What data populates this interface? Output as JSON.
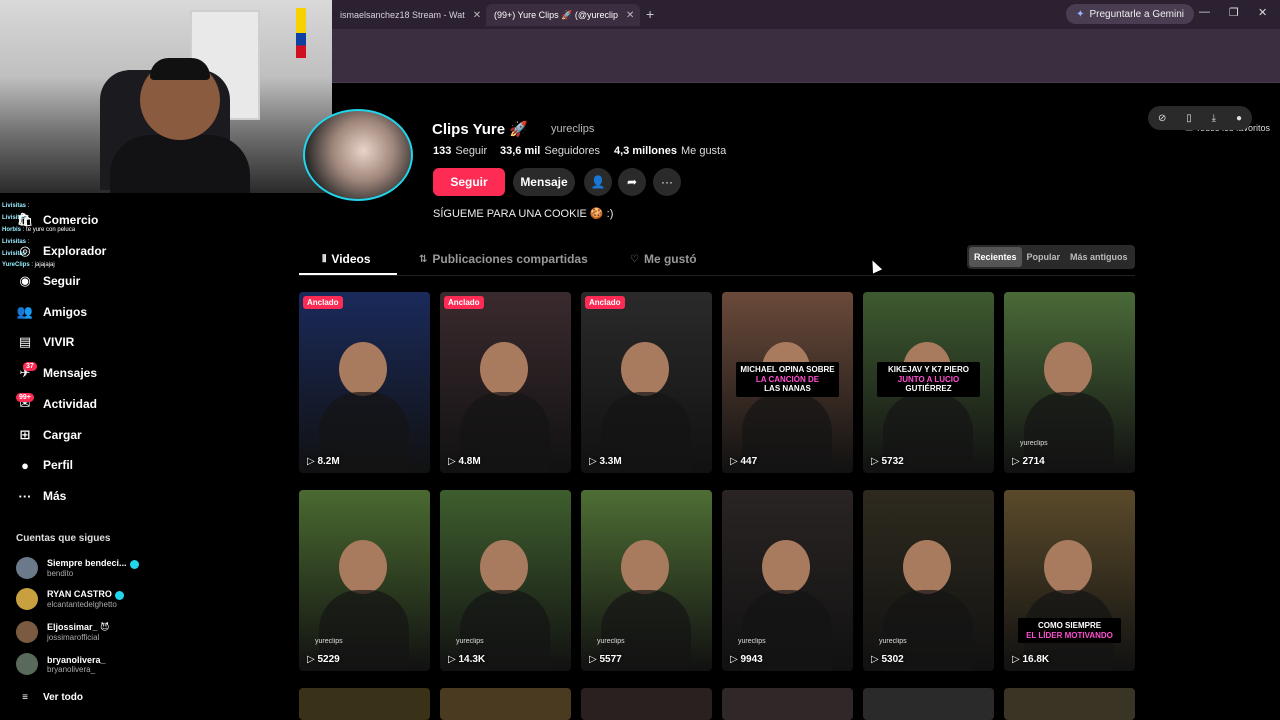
{
  "browser": {
    "tabs": [
      {
        "label": "ismaelsanchez18 Stream - Wat",
        "active": false
      },
      {
        "label": "(99+) Yure Clips 🚀 (@yureclip",
        "active": true
      }
    ],
    "gemini_label": "Preguntarle a Gemini",
    "bookmarks_all": "Todos los favoritos"
  },
  "chat": [
    {
      "user": "Livisitas",
      "text": ":"
    },
    {
      "user": "Livisitas",
      "text": ":"
    },
    {
      "user": "Horbis",
      "text": ": te yure con peluca"
    },
    {
      "user": "Livisitas",
      "text": ":"
    },
    {
      "user": "Livisitas",
      "text": ":"
    },
    {
      "user": "YureClips",
      "text": ": jajajajaj"
    }
  ],
  "sidebar": {
    "items": [
      {
        "icon": "shop-icon",
        "label": "Comercio"
      },
      {
        "icon": "compass-icon",
        "label": "Explorador"
      },
      {
        "icon": "following-icon",
        "label": "Seguir"
      },
      {
        "icon": "friends-icon",
        "label": "Amigos"
      },
      {
        "icon": "live-icon",
        "label": "VIVIR"
      },
      {
        "icon": "messages-icon",
        "label": "Mensajes",
        "badge": "37"
      },
      {
        "icon": "activity-icon",
        "label": "Actividad",
        "badge": "99+"
      },
      {
        "icon": "upload-icon",
        "label": "Cargar"
      },
      {
        "icon": "profile-icon",
        "label": "Perfil"
      },
      {
        "icon": "more-icon",
        "label": "Más"
      }
    ],
    "following_title": "Cuentas que sigues",
    "accounts": [
      {
        "name": "Siempre bendeci...",
        "handle": "bendito",
        "verified": true
      },
      {
        "name": "RYAN CASTRO",
        "handle": "elcantantedelghetto",
        "verified": true
      },
      {
        "name": "Eljossimar_ 😈",
        "handle": "jossimarofficial",
        "verified": false
      },
      {
        "name": "bryanolivera_",
        "handle": "bryanolivera_",
        "verified": false
      }
    ],
    "see_all": "Ver todo"
  },
  "profile": {
    "name": "Clips Yure 🚀",
    "handle": "yureclips",
    "following_count": "133",
    "following_label": "Seguir",
    "followers_count": "33,6 mil",
    "followers_label": "Seguidores",
    "likes_count": "4,3 millones",
    "likes_label": "Me gusta",
    "follow_button": "Seguir",
    "message_button": "Mensaje",
    "bio": "SÍGUEME PARA UNA COOKIE 🍪 :)"
  },
  "tabs": {
    "videos": "Videos",
    "reposts": "Publicaciones compartidas",
    "liked": "Me gustó"
  },
  "sort": {
    "recent": "Recientes",
    "popular": "Popular",
    "oldest": "Más antiguos"
  },
  "videos": [
    {
      "pinned": "Anclado",
      "views": "8.2M",
      "bg": "#1a2a5a"
    },
    {
      "pinned": "Anclado",
      "views": "4.8M",
      "bg": "#3a2a2e"
    },
    {
      "pinned": "Anclado",
      "views": "3.3M",
      "bg": "#2a2a2a"
    },
    {
      "views": "447",
      "bg": "#6a4a3a",
      "caption": [
        "MICHAEL OPINA SOBRE",
        "LA CANCIÓN DE",
        "LAS NANAS"
      ]
    },
    {
      "views": "5732",
      "bg": "#3e5a30",
      "caption": [
        "KIKEJAV Y K7 PIERO",
        "JUNTO A LUCIO",
        "GUTIÉRREZ"
      ]
    },
    {
      "views": "2714",
      "bg": "#4a6a38",
      "watermark": "yureclips"
    },
    {
      "views": "5229",
      "bg": "#4a6a30",
      "watermark": "yureclips"
    },
    {
      "views": "14.3K",
      "bg": "#3e5e2e",
      "watermark": "yureclips"
    },
    {
      "views": "5577",
      "bg": "#4e6e34",
      "watermark": "yureclips"
    },
    {
      "views": "9943",
      "bg": "#2a2424",
      "watermark": "yureclips"
    },
    {
      "views": "5302",
      "bg": "#2e2a1e",
      "watermark": "yureclips"
    },
    {
      "views": "16.8K",
      "bg": "#5a4a2a",
      "caption": [
        "COMO SIEMPRE",
        "EL LÍDER MOTIVANDO"
      ]
    }
  ]
}
